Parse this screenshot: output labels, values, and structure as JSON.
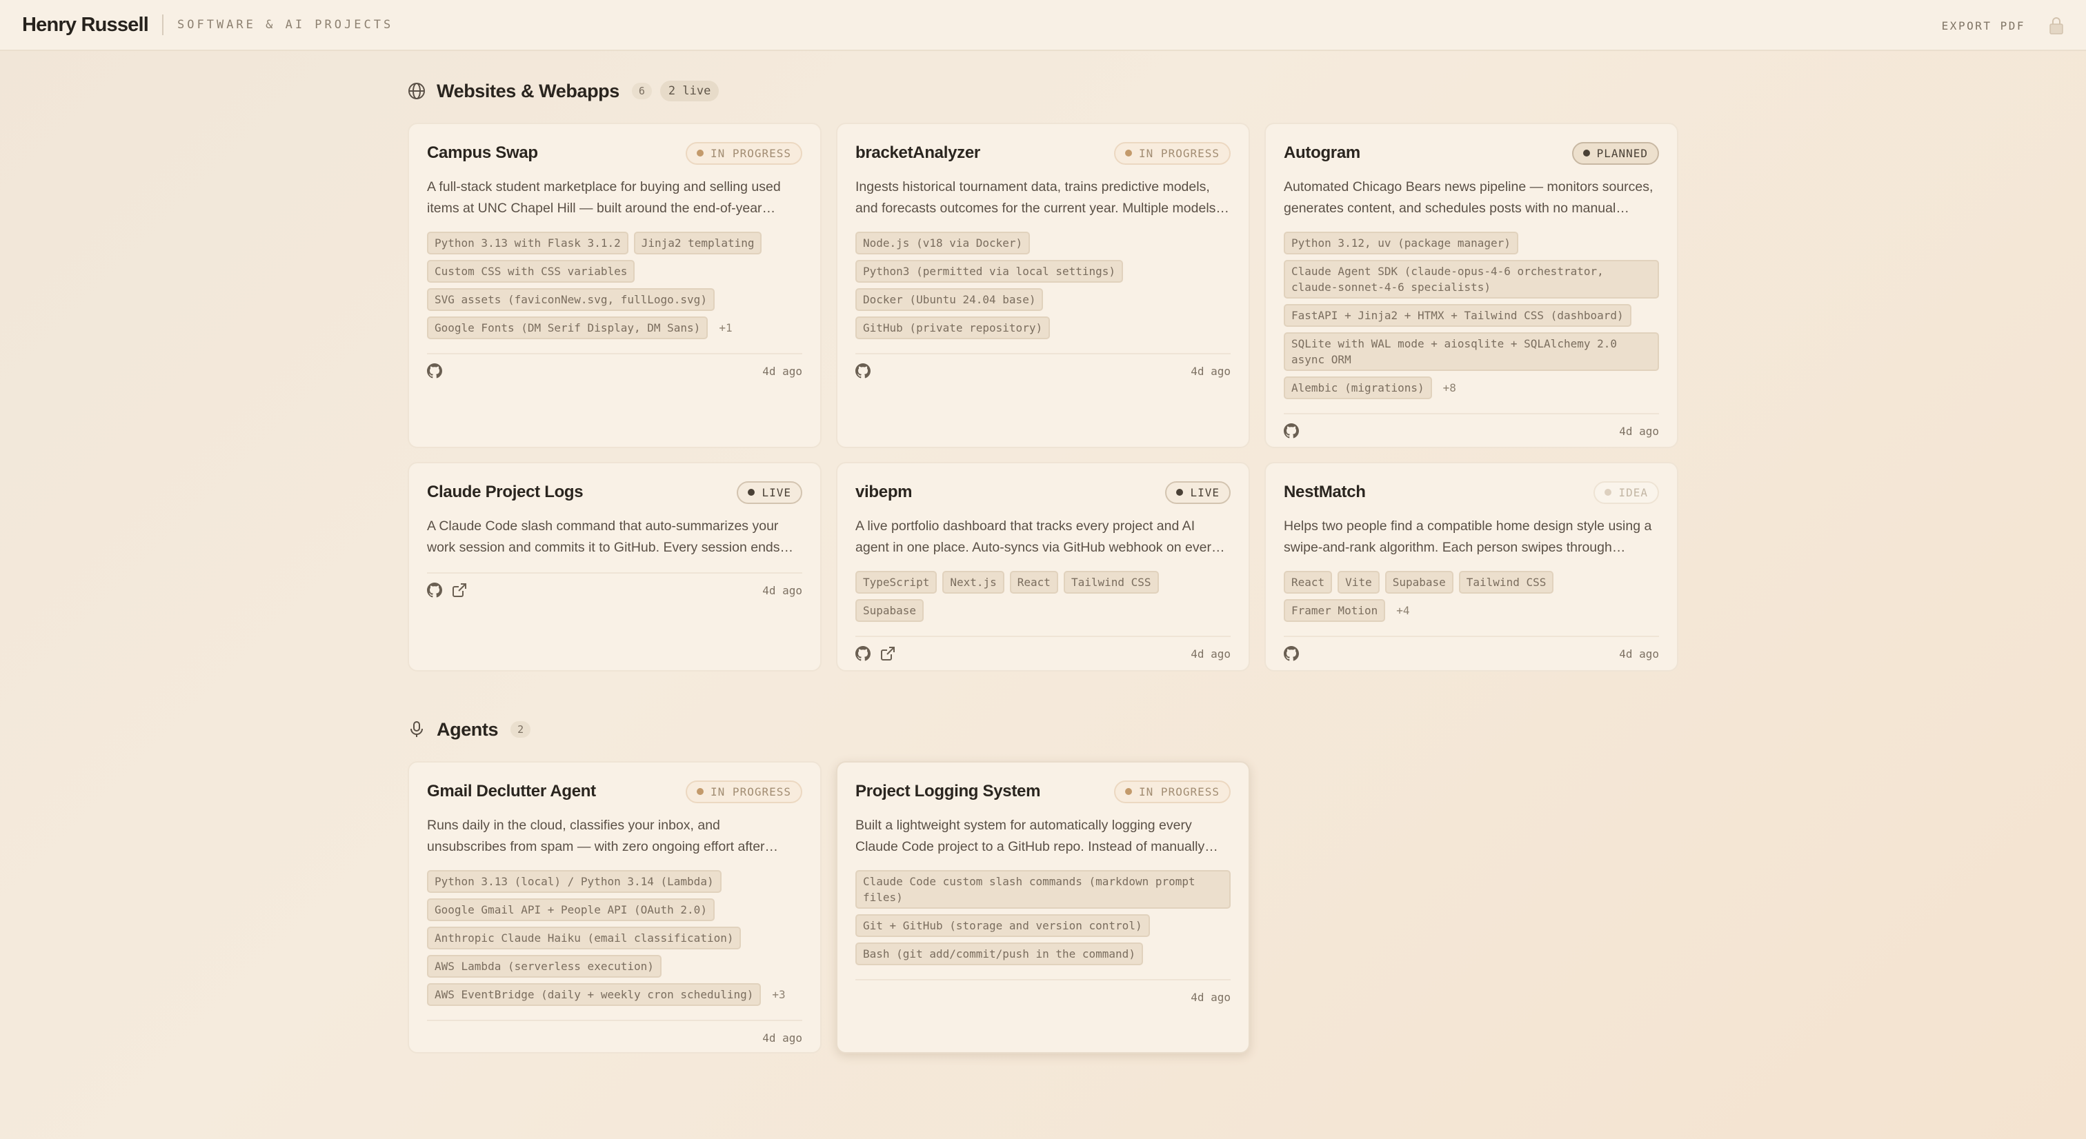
{
  "header": {
    "name": "Henry Russell",
    "subtitle": "SOFTWARE & AI PROJECTS",
    "export_label": "EXPORT PDF"
  },
  "sections": [
    {
      "title": "Websites & Webapps",
      "count": "6",
      "live": "2 live",
      "icon": "globe-icon",
      "cards": [
        {
          "title": "Campus Swap",
          "status": "IN PROGRESS",
          "desc": "A full-stack student marketplace for buying and selling used items at UNC Chapel Hill — built around the end-of-year move-out rush.",
          "tags": [
            "Python 3.13 with Flask 3.1.2",
            "Jinja2 templating",
            "Custom CSS with CSS variables",
            "SVG assets (faviconNew.svg, fullLogo.svg)",
            "Google Fonts (DM Serif Display, DM Sans)"
          ],
          "more": "+1",
          "age": "4d ago"
        },
        {
          "title": "bracketAnalyzer",
          "status": "IN PROGRESS",
          "desc": "Ingests historical tournament data, trains predictive models, and forecasts outcomes for the current year. Multiple models compared.",
          "tags": [
            "Node.js (v18 via Docker)",
            "Python3 (permitted via local settings)",
            "Docker (Ubuntu 24.04 base)",
            "GitHub (private repository)"
          ],
          "age": "4d ago"
        },
        {
          "title": "Autogram",
          "status": "PLANNED",
          "desc": "Automated Chicago Bears news pipeline — monitors sources, generates content, and schedules posts with no manual intervention.",
          "tags": [
            "Python 3.12, uv (package manager)",
            "Claude Agent SDK (claude-opus-4-6 orchestrator, claude-sonnet-4-6 specialists)",
            "FastAPI + Jinja2 + HTMX + Tailwind CSS (dashboard)",
            "SQLite with WAL mode + aiosqlite + SQLAlchemy 2.0 async ORM",
            "Alembic (migrations)"
          ],
          "more": "+8",
          "age": "4d ago"
        },
        {
          "title": "Claude Project Logs",
          "status": "LIVE",
          "desc": "A Claude Code slash command that auto-summarizes your work session and commits it to GitHub. Every session ends with a log entry.",
          "age": "4d ago"
        },
        {
          "title": "vibepm",
          "status": "LIVE",
          "desc": "A live portfolio dashboard that tracks every project and AI agent in one place. Auto-syncs via GitHub webhook on every push.",
          "tags": [
            "TypeScript",
            "Next.js",
            "React",
            "Tailwind CSS",
            "Supabase"
          ],
          "age": "4d ago"
        },
        {
          "title": "NestMatch",
          "status": "IDEA",
          "desc": "Helps two people find a compatible home design style using a swipe-and-rank algorithm. Each person swipes through images.",
          "tags": [
            "React",
            "Vite",
            "Supabase",
            "Tailwind CSS",
            "Framer Motion"
          ],
          "more": "+4",
          "age": "4d ago"
        }
      ]
    },
    {
      "title": "Agents",
      "count": "2",
      "icon": "mic-icon",
      "cards": [
        {
          "title": "Gmail Declutter Agent",
          "status": "IN PROGRESS",
          "desc": "Runs daily in the cloud, classifies your inbox, and unsubscribes from spam — with zero ongoing effort after setup.",
          "tags": [
            "Python 3.13 (local) / Python 3.14 (Lambda)",
            "Google Gmail API + People API (OAuth 2.0)",
            "Anthropic Claude Haiku (email classification)",
            "AWS Lambda (serverless execution)",
            "AWS EventBridge (daily + weekly cron scheduling)"
          ],
          "more": "+3",
          "age": "4d ago"
        },
        {
          "title": "Project Logging System",
          "status": "IN PROGRESS",
          "desc": "Built a lightweight system for automatically logging every Claude Code project to a GitHub repo. Instead of manually writing notes.",
          "tags": [
            "Claude Code custom slash commands (markdown prompt files)",
            "Git + GitHub (storage and version control)",
            "Bash (git add/commit/push in the command)"
          ],
          "age": "4d ago"
        }
      ]
    }
  ],
  "colors": {
    "background": "#f3e8da",
    "card": "#f9f1e6",
    "tag": "#ecdfcd",
    "status_progress": "#c39a6b",
    "status_live": "#4a4136"
  }
}
